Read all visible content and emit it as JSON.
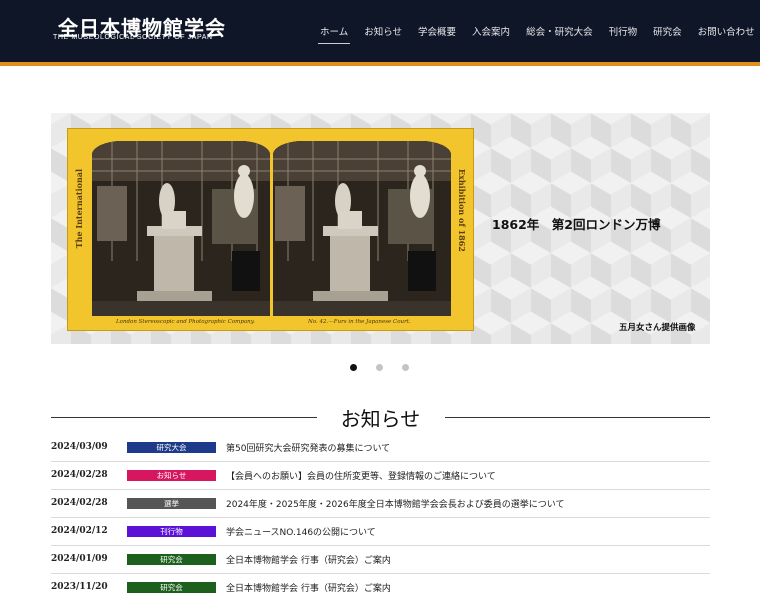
{
  "header": {
    "title": "全日本博物館学会",
    "subtitle": "THE MUSEOLOGICAL SOCIETY OF JAPAN",
    "nav": [
      {
        "label": "ホーム",
        "active": true
      },
      {
        "label": "お知らせ"
      },
      {
        "label": "学会概要"
      },
      {
        "label": "入会案内"
      },
      {
        "label": "総会・研究大会"
      },
      {
        "label": "刊行物"
      },
      {
        "label": "研究会"
      },
      {
        "label": "お問い合わせ"
      }
    ],
    "accent_color": "#e0901a",
    "bg_color": "#0e1628"
  },
  "slider": {
    "caption": "1862年　第2回ロンドン万博",
    "credit": "五月女さん提供画像",
    "card_side_left": "The International",
    "card_side_right": "Exhibition of 1862",
    "card_caption_left": "London Stereoscopic and Photographic Company.",
    "card_caption_right": "No. 42.—Furs in the Japanese Court.",
    "slide_count": 3,
    "active_index": 0
  },
  "news": {
    "heading": "お知らせ",
    "items": [
      {
        "date": "2024/03/09",
        "category": "研究大会",
        "color": "#1e3a8a",
        "text": "第50回研究大会研究発表の募集について"
      },
      {
        "date": "2024/02/28",
        "category": "お知らせ",
        "color": "#d6175f",
        "text": "【会員へのお願い】会員の住所変更等、登録情報のご連絡について"
      },
      {
        "date": "2024/02/28",
        "category": "選挙",
        "color": "#555555",
        "text": "2024年度・2025年度・2026年度全日本博物館学会会長および委員の選挙について"
      },
      {
        "date": "2024/02/12",
        "category": "刊行物",
        "color": "#5b12d6",
        "text": "学会ニュースNO.146の公開について"
      },
      {
        "date": "2024/01/09",
        "category": "研究会",
        "color": "#1d5f1d",
        "text": "全日本博物館学会 行事（研究会）ご案内"
      },
      {
        "date": "2023/11/20",
        "category": "研究会",
        "color": "#1d5f1d",
        "text": "全日本博物館学会 行事（研究会）ご案内"
      }
    ]
  }
}
